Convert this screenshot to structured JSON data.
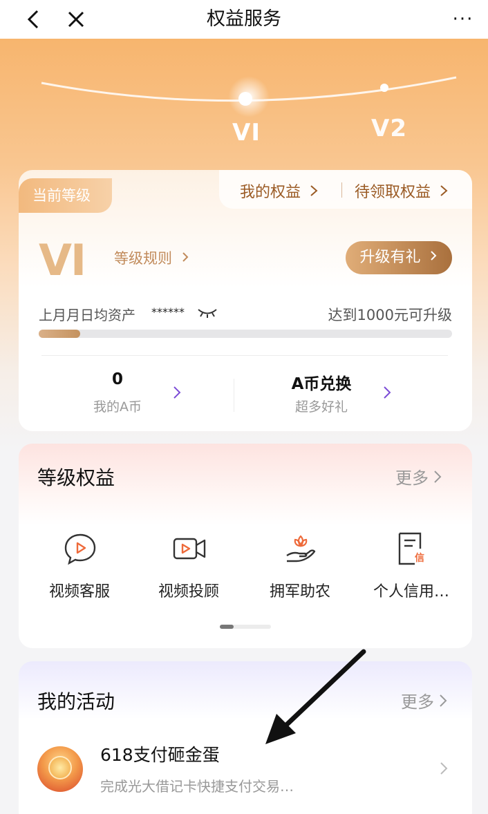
{
  "nav": {
    "title": "权益服务",
    "more": "···"
  },
  "hero": {
    "levels": [
      "VI",
      "V2"
    ]
  },
  "level_card": {
    "current_tab": "当前等级",
    "my_benefits": "我的权益",
    "pending_benefits": "待领取权益",
    "level": "VI",
    "grade_rule": "等级规则",
    "upgrade_button": "升级有礼",
    "asset_label": "上月月日均资产",
    "asset_mask": "******",
    "upgrade_hint": "达到1000元可升级",
    "progress": 0.1,
    "coin_value": "0",
    "coin_label": "我的A币",
    "exchange_title": "A币兑换",
    "exchange_sub": "超多好礼"
  },
  "benefits": {
    "title": "等级权益",
    "more": "更多",
    "items": [
      {
        "label": "视频客服",
        "icon": "chat-play-icon"
      },
      {
        "label": "视频投顾",
        "icon": "video-camera-icon"
      },
      {
        "label": "拥军助农",
        "icon": "hand-flower-icon"
      },
      {
        "label": "个人信用…",
        "icon": "credit-document-icon"
      }
    ]
  },
  "activities": {
    "title": "我的活动",
    "more": "更多",
    "items": [
      {
        "name": "618支付砸金蛋",
        "desc": "完成光大借记卡快捷支付交易…"
      }
    ]
  },
  "colors": {
    "accent_gold": "#c4925f",
    "hero_orange": "#f7b56e",
    "chevron_purple": "#7b4bd6"
  }
}
